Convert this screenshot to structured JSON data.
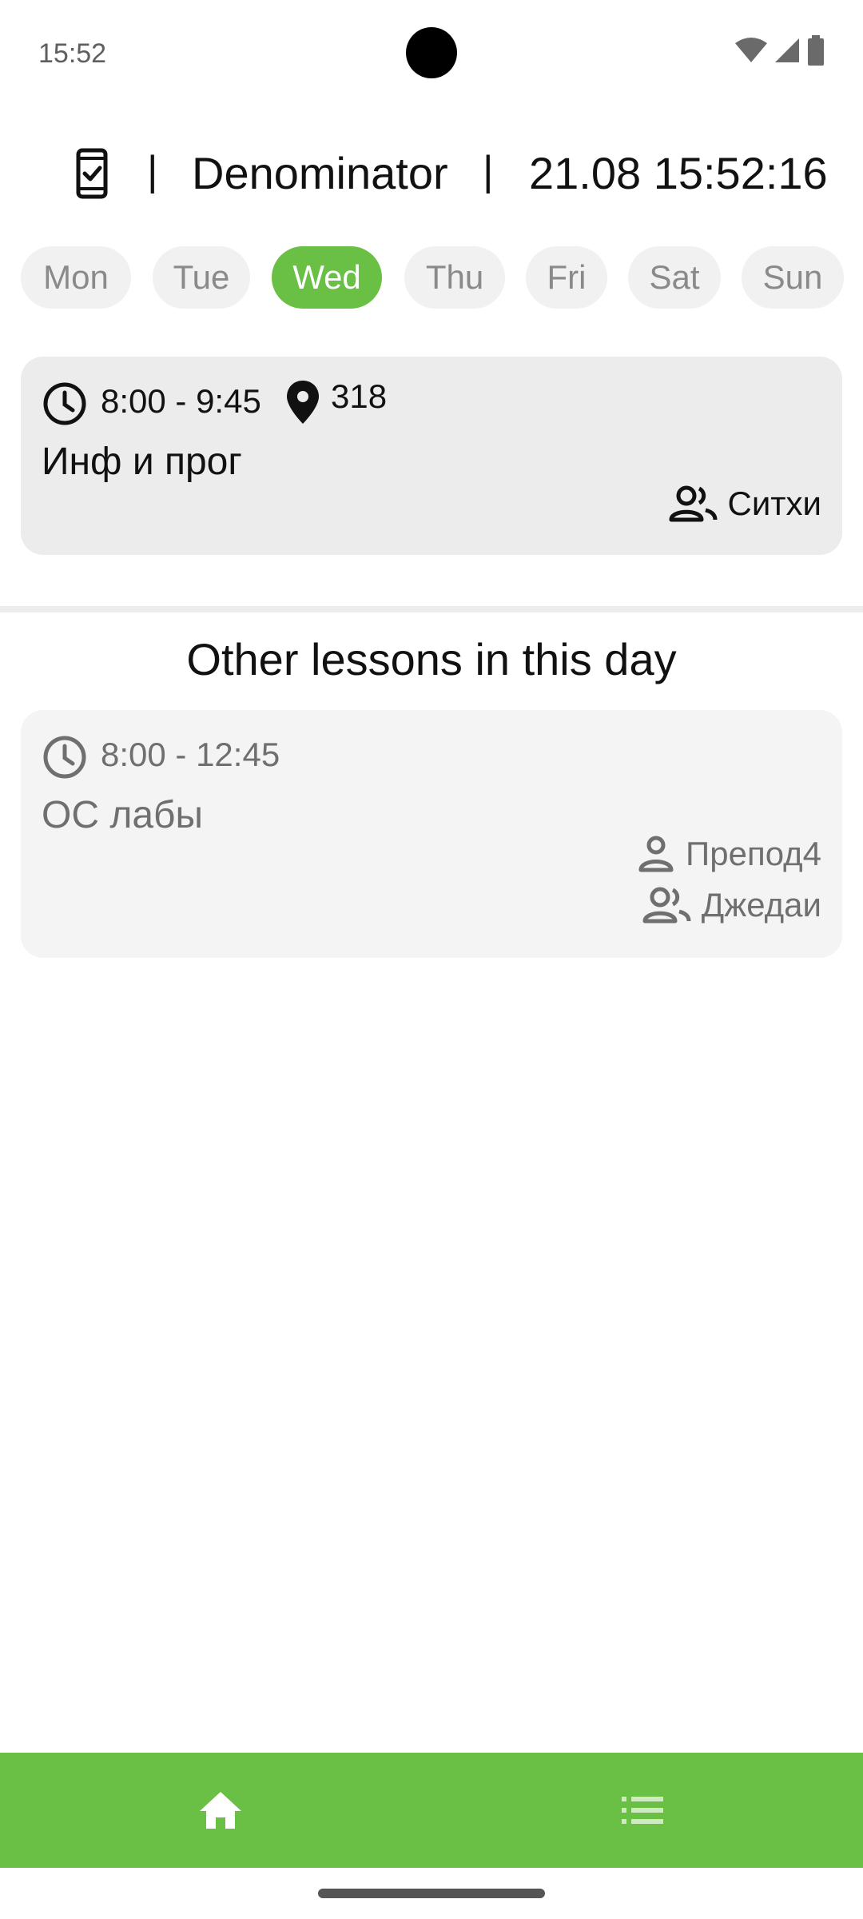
{
  "status_bar": {
    "time": "15:52",
    "icons": [
      "wifi-icon",
      "cellular-signal-icon",
      "battery-icon"
    ]
  },
  "header": {
    "icon": "phone-check-icon",
    "separator": "|",
    "week_type": "Denominator",
    "datetime": "21.08 15:52:16"
  },
  "days": [
    {
      "label": "Mon",
      "active": false
    },
    {
      "label": "Tue",
      "active": false
    },
    {
      "label": "Wed",
      "active": true
    },
    {
      "label": "Thu",
      "active": false
    },
    {
      "label": "Fri",
      "active": false
    },
    {
      "label": "Sat",
      "active": false
    },
    {
      "label": "Sun",
      "active": false
    }
  ],
  "current_lesson": {
    "time": "8:00 - 9:45",
    "room": "318",
    "subject": "Инф и прог",
    "group": "Ситхи"
  },
  "other_section": {
    "title": "Other lessons in this day"
  },
  "other_lessons": [
    {
      "time": "8:00 - 12:45",
      "subject": "ОС лабы",
      "teacher": "Препод4",
      "group": "Джедаи"
    }
  ],
  "bottom_nav": {
    "items": [
      "home-icon",
      "list-icon"
    ]
  },
  "colors": {
    "accent": "#6abf45",
    "chip_bg": "#f1f1f1",
    "card_bg": "#ececec",
    "other_card_bg": "#f4f4f4"
  }
}
